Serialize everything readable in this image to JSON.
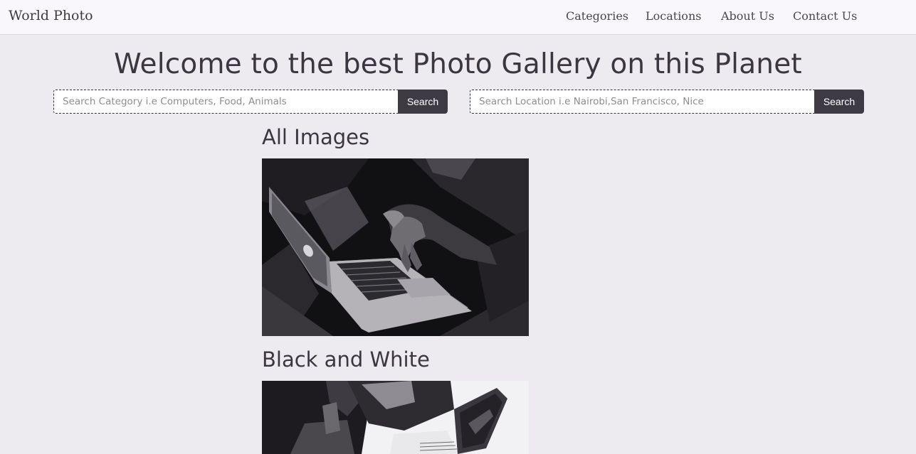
{
  "navbar": {
    "brand": "World Photo",
    "links": [
      "Categories",
      "Locations",
      "About Us",
      "Contact Us"
    ]
  },
  "hero": {
    "title": "Welcome to the best Photo Gallery on this Planet"
  },
  "search": {
    "category": {
      "placeholder": "Search Category i.e Computers, Food, Animals",
      "button": "Search"
    },
    "location": {
      "placeholder": "Search Location i.e Nairobi,San Francisco, Nice",
      "button": "Search"
    }
  },
  "sections": [
    {
      "title": "All Images"
    },
    {
      "title": "Black and White"
    }
  ],
  "colors": {
    "background": "#edeaf0",
    "navbar": "#f9f7fb",
    "button": "#3e3a44",
    "text": "#3b3640"
  }
}
